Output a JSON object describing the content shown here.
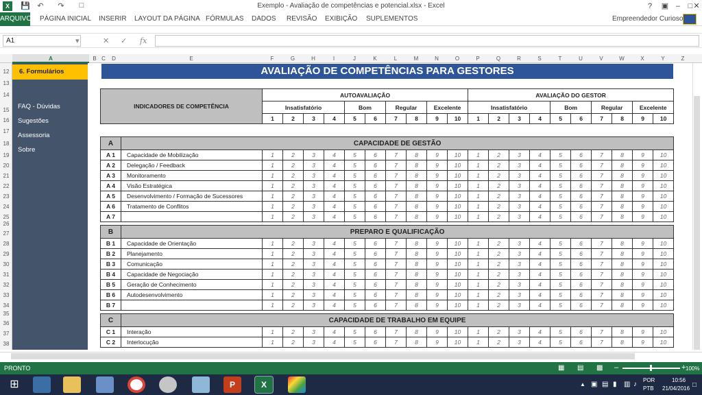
{
  "window": {
    "title": "Exemplo - Avaliação de competências e potencial.xlsx - Excel",
    "user": "Empreendedor Curioso"
  },
  "ribbon": {
    "file_tab": "ARQUIVO",
    "tabs": [
      "PÁGINA INICIAL",
      "INSERIR",
      "LAYOUT DA PÁGINA",
      "FÓRMULAS",
      "DADOS",
      "REVISÃO",
      "EXIBIÇÃO",
      "SUPLEMENTOS"
    ]
  },
  "formula_bar": {
    "name_box": "A1",
    "formula": ""
  },
  "columns": [
    "A",
    "B",
    "C",
    "D",
    "E",
    "F",
    "G",
    "H",
    "I",
    "J",
    "K",
    "L",
    "M",
    "N",
    "O",
    "P",
    "Q",
    "R",
    "S",
    "T",
    "U",
    "V",
    "W",
    "X",
    "Y",
    "Z"
  ],
  "rows": [
    "12",
    "13",
    "14",
    "15",
    "16",
    "17",
    "18",
    "19",
    "20",
    "21",
    "22",
    "23",
    "24",
    "25",
    "26",
    "27",
    "28",
    "29",
    "30",
    "31",
    "32",
    "33",
    "34",
    "35",
    "36",
    "37",
    "38"
  ],
  "sidebar": {
    "active": "6. Formulários",
    "items": [
      "FAQ - Dúvidas",
      "Sugestões",
      "Assessoria",
      "Sobre"
    ]
  },
  "sheet": {
    "title": "AVALIAÇÃO DE COMPETÊNCIAS PARA GESTORES",
    "indicators_header": "INDICADORES DE COMPETÊNCIA",
    "self_header": "AUTOAVALIAÇÃO",
    "manager_header": "AVALIAÇÃO DO GESTOR",
    "scale_groups": [
      "Insatisfatório",
      "Bom",
      "Regular",
      "Excelente"
    ],
    "scale": [
      "1",
      "2",
      "3",
      "4",
      "5",
      "6",
      "7",
      "8",
      "9",
      "10"
    ],
    "sections": [
      {
        "code": "A",
        "title": "CAPACIDADE DE GESTÃO",
        "items": [
          {
            "code": "A 1",
            "label": "Capacidade de Mobilização"
          },
          {
            "code": "A 2",
            "label": "Delegação / Feedback"
          },
          {
            "code": "A 3",
            "label": "Monitoramento"
          },
          {
            "code": "A 4",
            "label": "Visão Estratégica"
          },
          {
            "code": "A 5",
            "label": "Desenvolvimento / Formação de Sucessores"
          },
          {
            "code": "A 6",
            "label": "Tratamento de Conflitos"
          },
          {
            "code": "A 7",
            "label": ""
          }
        ]
      },
      {
        "code": "B",
        "title": "PREPARO E QUALIFICAÇÃO",
        "items": [
          {
            "code": "B 1",
            "label": "Capacidade de Orientação"
          },
          {
            "code": "B 2",
            "label": "Planejamento"
          },
          {
            "code": "B 3",
            "label": "Comunicação"
          },
          {
            "code": "B 4",
            "label": "Capacidade de Negociação"
          },
          {
            "code": "B 5",
            "label": "Geração de Conhecimento"
          },
          {
            "code": "B 6",
            "label": "Autodesenvolvimento"
          },
          {
            "code": "B 7",
            "label": ""
          }
        ]
      },
      {
        "code": "C",
        "title": "CAPACIDADE DE TRABALHO EM EQUIPE",
        "items": [
          {
            "code": "C 1",
            "label": "Interação"
          },
          {
            "code": "C 2",
            "label": "Interlocução"
          }
        ]
      }
    ]
  },
  "status": {
    "ready": "PRONTO",
    "zoom": "100%"
  },
  "taskbar": {
    "lang": "POR",
    "kbd": "PTB",
    "time": "10:56",
    "date": "21/04/2016"
  }
}
